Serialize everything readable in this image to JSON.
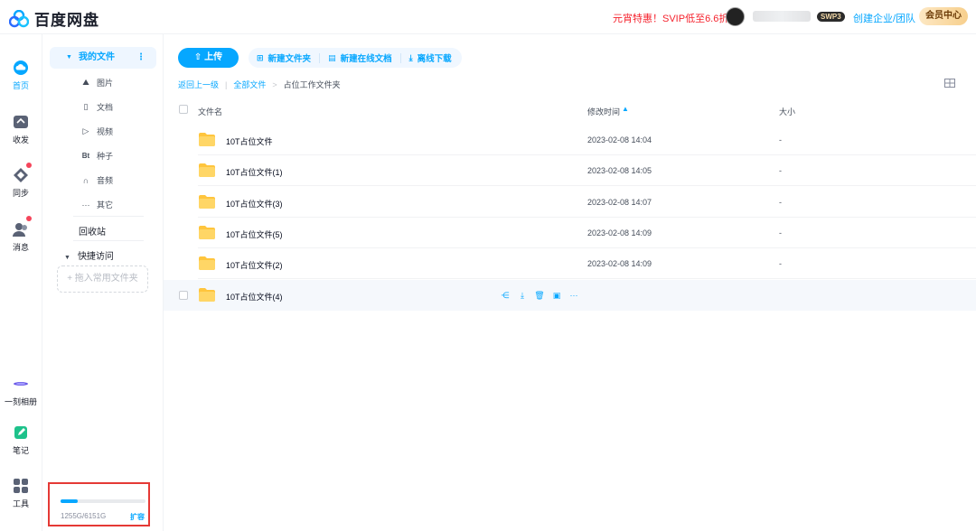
{
  "header": {
    "brand": "百度网盘",
    "promo": "元宵特惠！SVIP低至6.6折",
    "vip_level": "SWP3",
    "create_enterprise": "创建企业/团队",
    "member_center": "会员中心"
  },
  "rail": {
    "items": [
      {
        "label": "首页",
        "icon": "cloud-home-icon",
        "active": true
      },
      {
        "label": "收发",
        "icon": "transfer-icon"
      },
      {
        "label": "同步",
        "icon": "sync-icon",
        "badge": true
      },
      {
        "label": "消息",
        "icon": "message-icon",
        "badge": true
      },
      {
        "label": "一刻相册",
        "icon": "album-icon"
      },
      {
        "label": "笔记",
        "icon": "note-icon"
      },
      {
        "label": "工具",
        "icon": "tools-icon"
      }
    ]
  },
  "sidebar": {
    "my_files": "我的文件",
    "categories": [
      {
        "label": "图片",
        "icon": "image-icon"
      },
      {
        "label": "文档",
        "icon": "document-icon"
      },
      {
        "label": "视频",
        "icon": "video-icon"
      },
      {
        "label": "种子",
        "icon": "bt-icon"
      },
      {
        "label": "音频",
        "icon": "audio-icon"
      },
      {
        "label": "其它",
        "icon": "more-icon"
      }
    ],
    "recycle": "回收站",
    "quick_access": "快捷访问",
    "drop_hint": "+ 拖入常用文件夹",
    "quota": {
      "text": "1255G/6151G",
      "used_fraction": 0.204,
      "expand": "扩容"
    }
  },
  "toolbar": {
    "upload": "上传",
    "new_folder": "新建文件夹",
    "new_online_doc": "新建在线文档",
    "offline_download": "离线下载"
  },
  "breadcrumb": {
    "back": "返回上一级",
    "all_files": "全部文件",
    "current": "占位工作文件夹"
  },
  "table": {
    "col_name": "文件名",
    "col_modified": "修改时间",
    "col_size": "大小",
    "rows": [
      {
        "name": "10T占位文件",
        "modified": "2023-02-08 14:04",
        "size": "-"
      },
      {
        "name": "10T占位文件(1)",
        "modified": "2023-02-08 14:05",
        "size": "-"
      },
      {
        "name": "10T占位文件(3)",
        "modified": "2023-02-08 14:07",
        "size": "-"
      },
      {
        "name": "10T占位文件(5)",
        "modified": "2023-02-08 14:09",
        "size": "-"
      },
      {
        "name": "10T占位文件(2)",
        "modified": "2023-02-08 14:09",
        "size": "-"
      },
      {
        "name": "10T占位文件(4)",
        "modified": "",
        "size": ""
      }
    ]
  },
  "colors": {
    "accent": "#06a7ff",
    "promo": "#f5222d",
    "folder": "#ffc53d"
  }
}
